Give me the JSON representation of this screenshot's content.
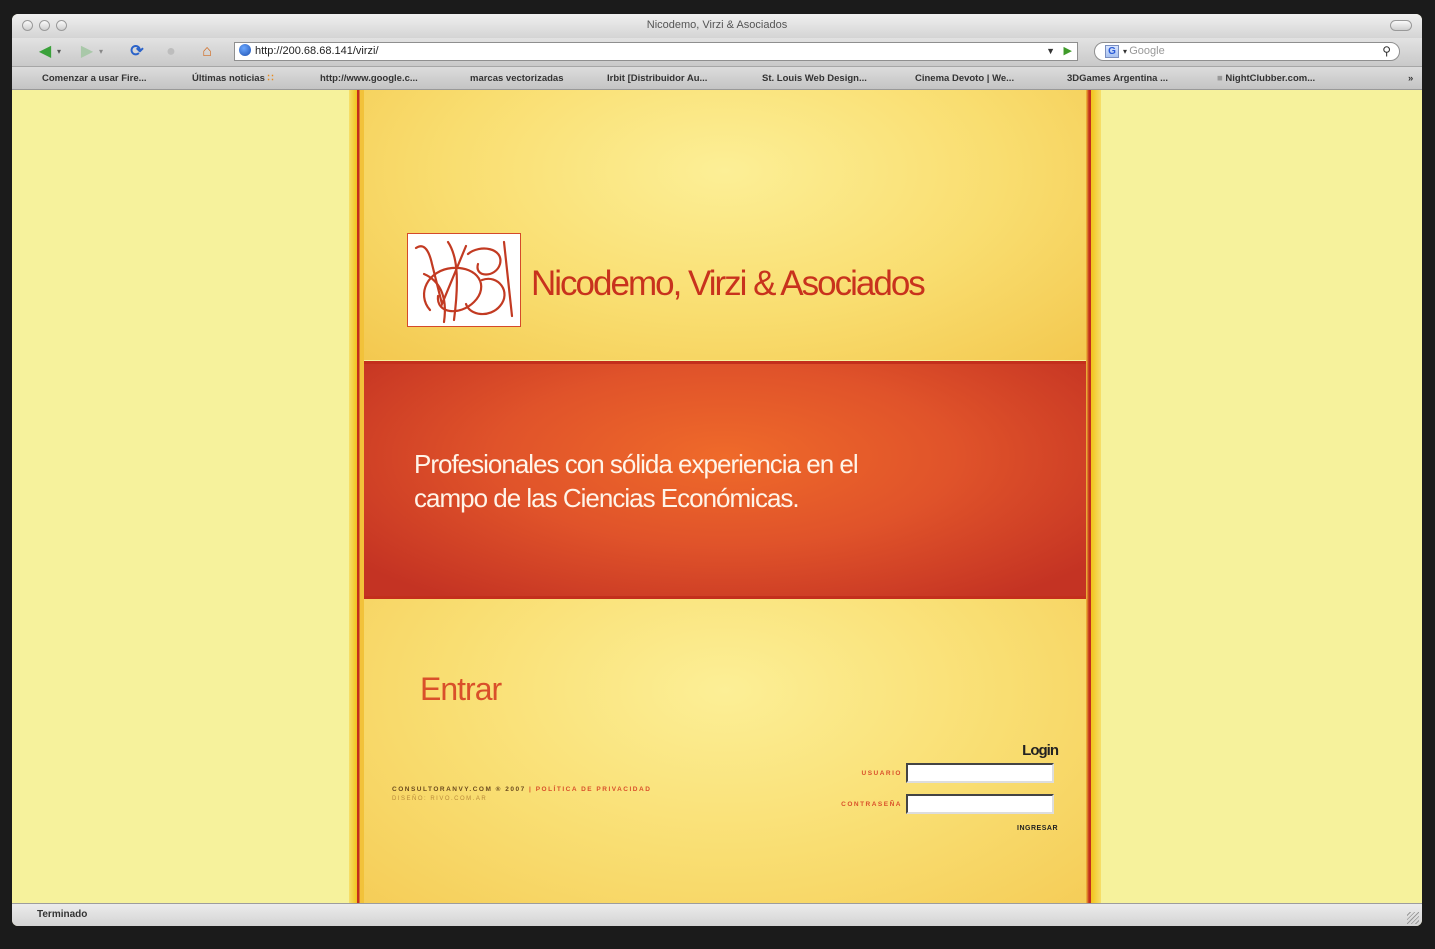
{
  "window": {
    "title": "Nicodemo, Virzi & Asociados"
  },
  "navbar": {
    "url": "http://200.68.68.141/virzi/",
    "search_placeholder": "Google",
    "search_engine_letter": "G"
  },
  "bookmarks": [
    "Comenzar a usar Fire...",
    "Últimas noticias",
    "http://www.google.c...",
    "marcas vectorizadas",
    "Irbit [Distribuidor Au...",
    "St. Louis Web Design...",
    "Cinema Devoto | We...",
    "3DGames Argentina ...",
    "NightClubber.com..."
  ],
  "bookmarks_more": "»",
  "site": {
    "brand_name": "Nicodemo, Virzi & Asociados",
    "tagline_line1": "Profesionales con sólida experiencia en el",
    "tagline_line2": "campo de las Ciencias Económicas.",
    "entrar": "Entrar",
    "footer_copy": "CONSULTORANVY.COM ® 2007",
    "footer_separator": " | ",
    "footer_privacy": "POLÍTICA DE PRIVACIDAD",
    "footer_credit": "DISEÑO: RIVO.COM.AR",
    "login": {
      "title": "Login",
      "user_label": "USUARIO",
      "password_label": "CONTRASEÑA",
      "user_value": "",
      "password_value": "",
      "submit": "INGRESAR"
    }
  },
  "status": {
    "text": "Terminado"
  },
  "colors": {
    "page_bg": "#f6f29c",
    "brand_red": "#c8321d",
    "banner_orange": "#e0532a",
    "accent_orange": "#d9502a"
  }
}
